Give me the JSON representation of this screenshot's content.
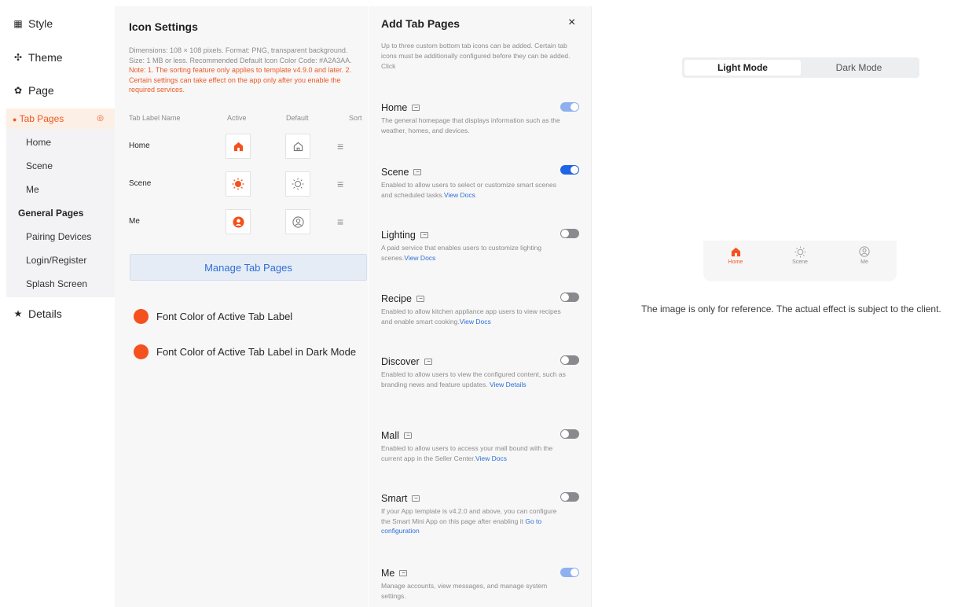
{
  "sidebar": {
    "style": "Style",
    "theme": "Theme",
    "page": "Page",
    "tab_pages": "Tab Pages",
    "sub_items": [
      "Home",
      "Scene",
      "Me"
    ],
    "general_pages": "General Pages",
    "general_items": [
      "Pairing Devices",
      "Login/Register",
      "Splash Screen"
    ],
    "details": "Details"
  },
  "settings": {
    "title": "Icon Settings",
    "desc": "Dimensions: 108 × 108 pixels. Format: PNG, transparent background. Size: 1 MB or less. Recommended Default Icon Color Code: #A2A3AA.",
    "note": "Note: 1. The sorting feature only applies to template v4.9.0 and later. 2. Certain settings can take effect on the app only after you enable the required services.",
    "headers": {
      "label": "Tab Label Name",
      "active": "Active",
      "default": "Default",
      "sort": "Sort"
    },
    "rows": [
      {
        "label": "Home"
      },
      {
        "label": "Scene"
      },
      {
        "label": "Me"
      }
    ],
    "manage_button": "Manage Tab Pages",
    "font_color_active": "Font Color of Active Tab Label",
    "font_color_active_dark": "Font Color of Active Tab Label in Dark Mode",
    "accent_color": "#F4511E"
  },
  "drawer": {
    "title": "Add Tab Pages",
    "close": "×",
    "intro": "Up to three custom bottom tab icons can be added. Certain tab icons must be additionally configured before they can be added. Click",
    "items": [
      {
        "name": "Home",
        "info": "The general homepage that displays information such as the weather, homes, and devices.",
        "link": "",
        "toggle": "on-locked"
      },
      {
        "name": "Scene",
        "info": "Enabled to allow users to select or customize smart scenes and scheduled tasks.",
        "link": "View Docs",
        "toggle": "on"
      },
      {
        "name": "Lighting",
        "info": "A paid service that enables users to customize lighting scenes.",
        "link": "View Docs",
        "toggle": "off"
      },
      {
        "name": "Recipe",
        "info": "Enabled to allow kitchen appliance app users to view recipes and enable smart cooking.",
        "link": "View Docs",
        "toggle": "off"
      },
      {
        "name": "Discover",
        "info": "Enabled to allow users to view the configured content, such as branding news and feature updates.",
        "link": "View Details",
        "toggle": "off"
      },
      {
        "name": "Mall",
        "info": "Enabled to allow users to access your mall bound with the current app in the Seller Center.",
        "link": "View Docs",
        "toggle": "off"
      },
      {
        "name": "Smart",
        "info": "If your App template is v4.2.0 and above, you can configure the Smart Mini App on this page after enabling it",
        "link": "Go to configuration",
        "toggle": "off"
      },
      {
        "name": "Me",
        "info": "Manage accounts, view messages, and manage system settings.",
        "link": "",
        "toggle": "on-locked"
      }
    ]
  },
  "preview": {
    "light_mode": "Light Mode",
    "dark_mode": "Dark Mode",
    "tabs": [
      "Home",
      "Scene",
      "Me"
    ],
    "note": "The image is only for reference. The actual effect is subject to the client."
  }
}
